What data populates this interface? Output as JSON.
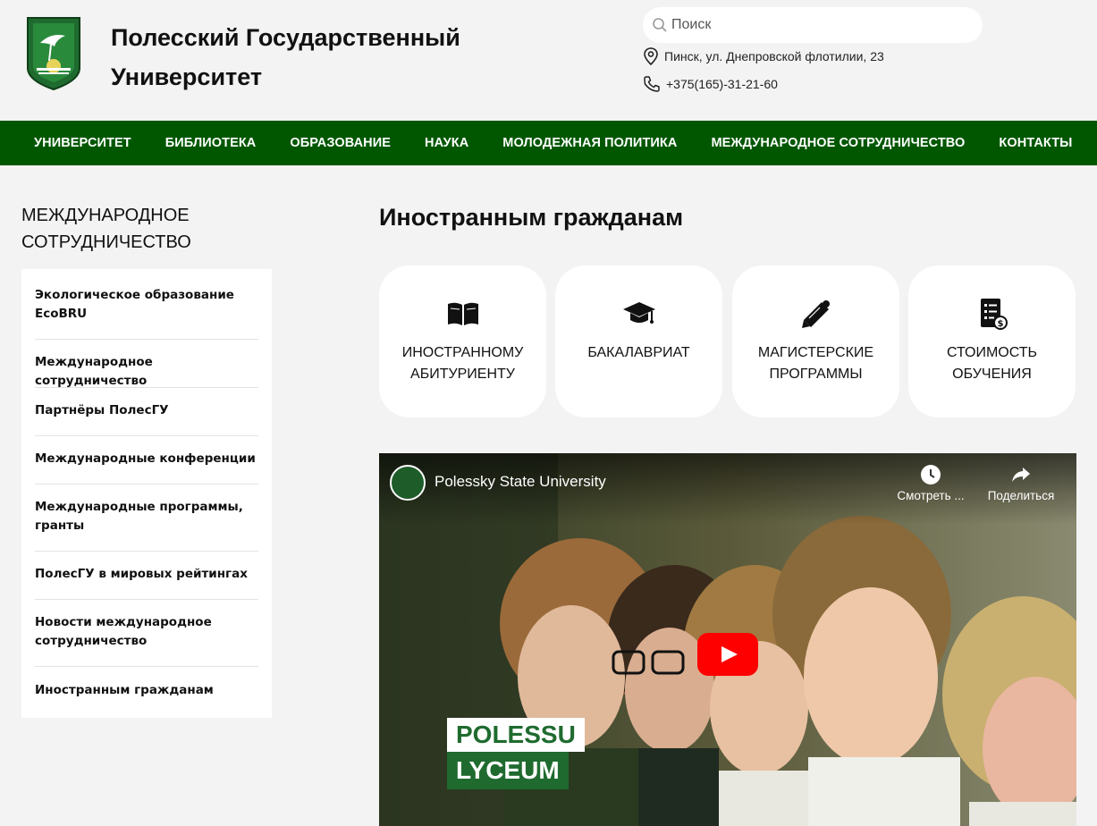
{
  "header": {
    "title_line1": "Полесский Государственный",
    "title_line2": "Университет",
    "search_placeholder": "Поиск",
    "address": "Пинск, ул. Днепровской флотилии, 23",
    "phone": "+375(165)-31-21-60"
  },
  "nav": {
    "items": [
      {
        "label": "УНИВЕРСИТЕТ"
      },
      {
        "label": "БИБЛИОТЕКА"
      },
      {
        "label": "ОБРАЗОВАНИЕ"
      },
      {
        "label": "НАУКА"
      },
      {
        "label": "МОЛОДЕЖНАЯ ПОЛИТИКА"
      },
      {
        "label": "МЕЖДУНАРОДНОЕ СОТРУДНИЧЕСТВО"
      },
      {
        "label": "КОНТАКТЫ"
      }
    ]
  },
  "sidebar": {
    "title_line1": "МЕЖДУНАРОДНОЕ",
    "title_line2": "СОТРУДНИЧЕСТВО",
    "items": [
      {
        "label": "Экологическое образование EcoBRU"
      },
      {
        "label": "Международное сотрудничество"
      },
      {
        "label": "Партнёры ПолесГУ"
      },
      {
        "label": "Международные конференции"
      },
      {
        "label": "Международные программы, гранты"
      },
      {
        "label": "ПолесГУ в мировых рейтингах"
      },
      {
        "label": "Новости международное сотрудничество"
      },
      {
        "label": "Иностранным гражданам"
      }
    ]
  },
  "main": {
    "title": "Иностранным гражданам",
    "cards": [
      {
        "line1": "ИНОСТРАННОМУ",
        "line2": "АБИТУРИЕНТУ",
        "icon": "open-book-icon"
      },
      {
        "line1": "БАКАЛАВРИАТ",
        "line2": "",
        "icon": "graduation-cap-icon"
      },
      {
        "line1": "МАГИСТЕРСКИЕ",
        "line2": "ПРОГРАММЫ",
        "icon": "diploma-scroll-icon"
      },
      {
        "line1": "СТОИМОСТЬ",
        "line2": "ОБУЧЕНИЯ",
        "icon": "checklist-cost-icon"
      }
    ]
  },
  "video": {
    "channel_title": "Polessky State University",
    "watch_later": "Смотреть ...",
    "share": "Поделиться",
    "overlay_line1": "POLESSU",
    "overlay_line2": "LYCEUM"
  },
  "colors": {
    "nav_bg": "#005700",
    "page_bg": "#f3f3f3",
    "youtube_red": "#ff0000",
    "brand_green": "#1f6b2f"
  }
}
